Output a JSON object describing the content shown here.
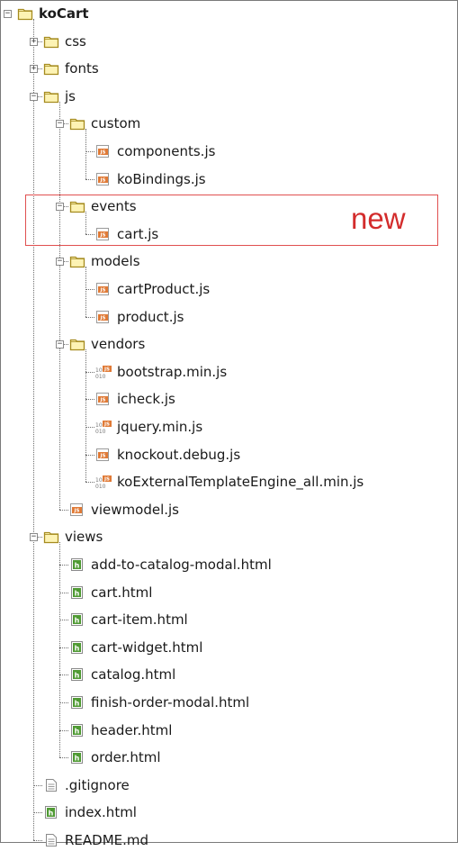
{
  "tree": [
    {
      "label": "koCart",
      "type": "folder",
      "depth": 0,
      "expanded": true,
      "root": true
    },
    {
      "label": "css",
      "type": "folder",
      "depth": 1,
      "expanded": false
    },
    {
      "label": "fonts",
      "type": "folder",
      "depth": 1,
      "expanded": false
    },
    {
      "label": "js",
      "type": "folder",
      "depth": 1,
      "expanded": true
    },
    {
      "label": "custom",
      "type": "folder",
      "depth": 2,
      "expanded": true
    },
    {
      "label": "components.js",
      "type": "js",
      "depth": 3
    },
    {
      "label": "koBindings.js",
      "type": "js",
      "depth": 3
    },
    {
      "label": "events",
      "type": "folder",
      "depth": 2,
      "expanded": true
    },
    {
      "label": "cart.js",
      "type": "js",
      "depth": 3
    },
    {
      "label": "models",
      "type": "folder",
      "depth": 2,
      "expanded": true
    },
    {
      "label": "cartProduct.js",
      "type": "js",
      "depth": 3
    },
    {
      "label": "product.js",
      "type": "js",
      "depth": 3
    },
    {
      "label": "vendors",
      "type": "folder",
      "depth": 2,
      "expanded": true
    },
    {
      "label": "bootstrap.min.js",
      "type": "minjs",
      "depth": 3
    },
    {
      "label": "icheck.js",
      "type": "js",
      "depth": 3
    },
    {
      "label": "jquery.min.js",
      "type": "minjs",
      "depth": 3
    },
    {
      "label": "knockout.debug.js",
      "type": "js",
      "depth": 3
    },
    {
      "label": "koExternalTemplateEngine_all.min.js",
      "type": "minjs",
      "depth": 3
    },
    {
      "label": "viewmodel.js",
      "type": "js",
      "depth": 2
    },
    {
      "label": "views",
      "type": "folder",
      "depth": 1,
      "expanded": true
    },
    {
      "label": "add-to-catalog-modal.html",
      "type": "html",
      "depth": 2
    },
    {
      "label": "cart.html",
      "type": "html",
      "depth": 2
    },
    {
      "label": "cart-item.html",
      "type": "html",
      "depth": 2
    },
    {
      "label": "cart-widget.html",
      "type": "html",
      "depth": 2
    },
    {
      "label": "catalog.html",
      "type": "html",
      "depth": 2
    },
    {
      "label": "finish-order-modal.html",
      "type": "html",
      "depth": 2
    },
    {
      "label": "header.html",
      "type": "html",
      "depth": 2
    },
    {
      "label": "order.html",
      "type": "html",
      "depth": 2
    },
    {
      "label": ".gitignore",
      "type": "text",
      "depth": 1
    },
    {
      "label": "index.html",
      "type": "html",
      "depth": 1
    },
    {
      "label": "README.md",
      "type": "text",
      "depth": 1
    }
  ],
  "annotation": {
    "text": "new"
  },
  "icons": {
    "folder": "folder-icon",
    "js": "js-file-icon",
    "minjs": "minified-js-file-icon",
    "html": "html-file-icon",
    "text": "text-file-icon"
  },
  "colors": {
    "folder_fill": "#fdf3b4",
    "folder_stroke": "#a58b1f",
    "js_badge": "#e07a36",
    "html_badge": "#4f9a33",
    "highlight": "#e05050",
    "annotation": "#d32c2c"
  }
}
